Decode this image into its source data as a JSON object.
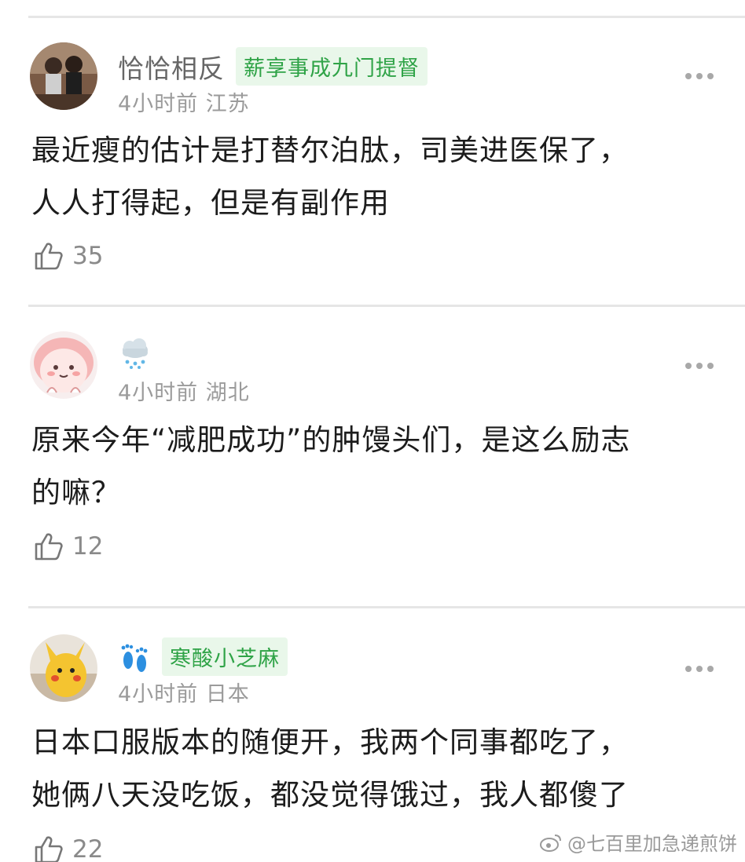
{
  "comments": [
    {
      "username": "恰恰相反",
      "badge": "薪享事成九门提督",
      "time": "4小时前",
      "location": "江苏",
      "text_lines": [
        "最近瘦的估计是打替尔泊肽，司美进医保了，",
        "人人打得起，但是有副作用"
      ],
      "likes": "35",
      "avatar": "avatar-two-women-photo"
    },
    {
      "username": "",
      "badge": "",
      "time": "4小时前",
      "location": "湖北",
      "text_lines": [
        "原来今年“减肥成功”的肿馒头们，是这么励志",
        "的嘛？"
      ],
      "likes": "12",
      "avatar": "avatar-pink-cartoon",
      "name_icon": "snow-cloud-icon"
    },
    {
      "username": "",
      "badge": "寒酸小芝麻",
      "time": "4小时前",
      "location": "日本",
      "text_lines": [
        "日本口服版本的随便开，我两个同事都吃了，",
        "她俩八天没吃饭，都没觉得饿过，我人都傻了"
      ],
      "likes": "22",
      "avatar": "avatar-yellow-plush",
      "name_icon": "footprints-icon"
    }
  ],
  "watermark": "@七百里加急递煎饼",
  "colors": {
    "badge_bg": "#e9f7ea",
    "badge_text": "#2fa347",
    "divider": "#e6e6e6"
  }
}
